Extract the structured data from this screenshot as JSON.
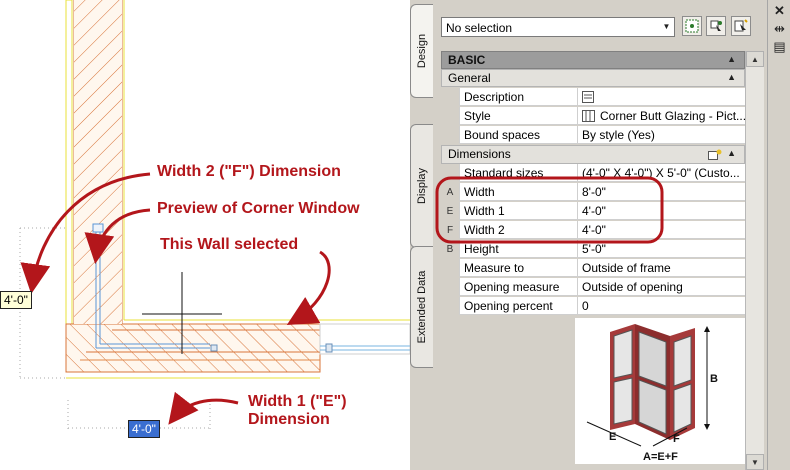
{
  "drawing": {
    "dimension_left": "4'-0\"",
    "dimension_bottom": "4'-0\"",
    "annotations": {
      "width2": "Width 2 (\"F\") Dimension",
      "preview": "Preview of Corner Window",
      "wall_selected": "This Wall selected",
      "width1_line1": "Width 1 (\"E\")",
      "width1_line2": "Dimension"
    },
    "annotation_color": "#b3161b"
  },
  "palette": {
    "selector_value": "No selection",
    "tabs": [
      "Design",
      "Display",
      "Extended Data"
    ],
    "toolbar_icons": [
      "quick-select-icon",
      "pick-add-icon",
      "select-objects-icon"
    ],
    "right_icons": [
      "close-icon",
      "auto-hide-icon",
      "properties-menu-icon"
    ],
    "basic_label": "BASIC",
    "general_label": "General",
    "dimensions_label": "Dimensions",
    "general_rows": [
      {
        "letter": "",
        "label": "Description",
        "value": "",
        "icon": "description-edit-icon"
      },
      {
        "letter": "",
        "label": "Style",
        "value": "Corner Butt Glazing - Pict...",
        "icon": "style-icon"
      },
      {
        "letter": "",
        "label": "Bound spaces",
        "value": "By style (Yes)",
        "icon": ""
      }
    ],
    "dimension_rows": [
      {
        "letter": "",
        "label": "Standard sizes",
        "value": "(4'-0\" X 4'-0\") X 5'-0\" (Custo..."
      },
      {
        "letter": "A",
        "label": "Width",
        "value": "8'-0\""
      },
      {
        "letter": "E",
        "label": "Width 1",
        "value": "4'-0\""
      },
      {
        "letter": "F",
        "label": "Width 2",
        "value": "4'-0\""
      },
      {
        "letter": "B",
        "label": "Height",
        "value": "5'-0\""
      },
      {
        "letter": "",
        "label": "Measure to",
        "value": "Outside of frame"
      },
      {
        "letter": "",
        "label": "Opening measure",
        "value": "Outside of opening"
      },
      {
        "letter": "",
        "label": "Opening percent",
        "value": "0"
      }
    ],
    "diagram_labels": {
      "b": "B",
      "e": "E",
      "f": "F",
      "formula": "A=E+F"
    }
  }
}
